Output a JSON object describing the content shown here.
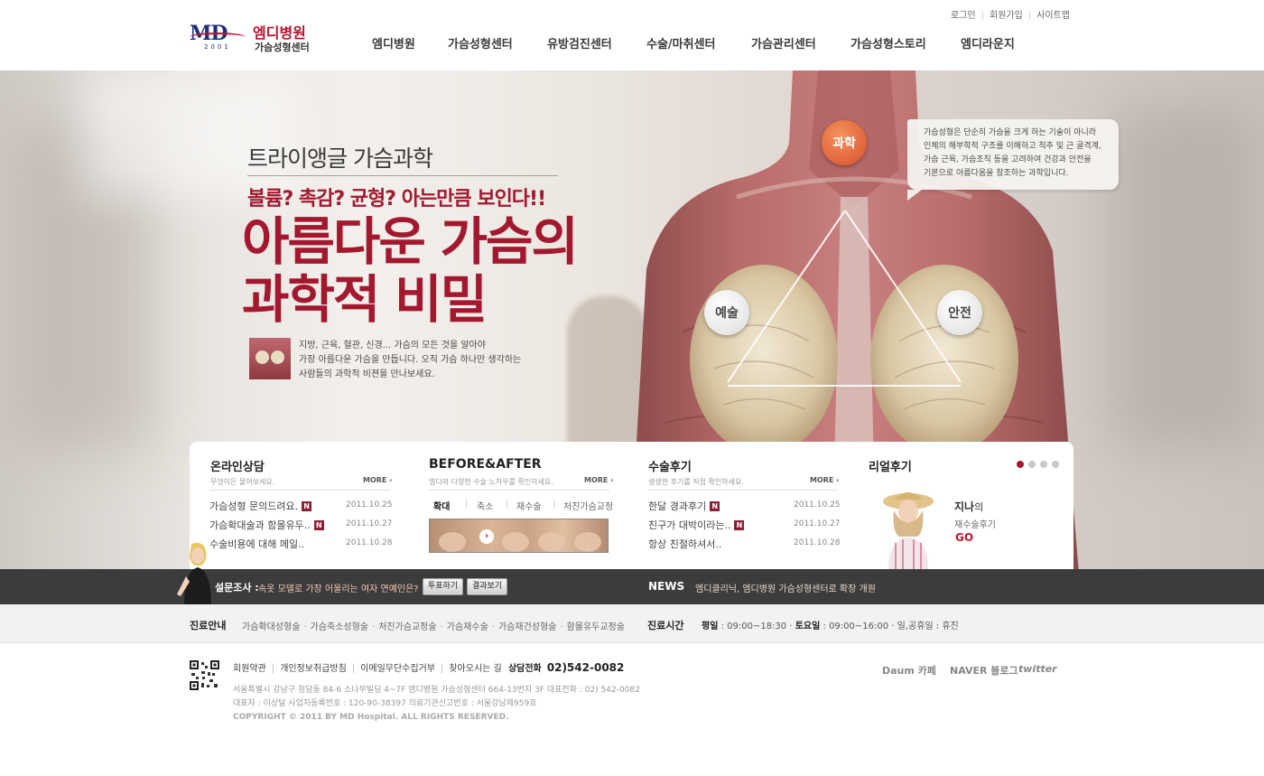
{
  "header": {
    "logo_text": "MD",
    "logo_year": "2001",
    "hospital_name": "엠디병원",
    "center_name": "가슴성형센터",
    "util_links": [
      "로그인",
      "회원가입",
      "사이트맵"
    ],
    "nav": [
      "엠디병원",
      "가슴성형센터",
      "유방검진센터",
      "수술/마취센터",
      "가슴관리센터",
      "가슴성형스토리",
      "엠디라운지"
    ]
  },
  "hero": {
    "subtitle": "트라이앵글 가슴과학",
    "slogan": "볼륨? 촉감? 균형? 아는만큼 보인다!!",
    "title_line1": "아름다운 가슴의",
    "title_line2": "과학적 비밀",
    "desc_line1": "지방, 근육, 혈관, 신경... 가슴의 모든 것을 알아야",
    "desc_line2": "가장 아름다운 가슴을 만듭니다. 오직 가슴 하나만 생각하는",
    "desc_line3": "사람들의 과학적 비젼을 만나보세요.",
    "triangle": {
      "top": "과학",
      "left": "예술",
      "right": "안전"
    },
    "bubble_lines": [
      "가슴성형은 단순히 가슴을 크게 하는 기술이 아니라",
      "인체의 해부학적 구조를 이해하고 척추 및 근 골격계,",
      "가슴 근육, 가슴조직 등을 고려하여 건강과 안전을",
      "기본으로 아름다움을 창조하는 과학입니다."
    ]
  },
  "consult": {
    "title": "온라인상담",
    "sub": "무엇이든 물어보세요.",
    "more": "MORE",
    "items": [
      {
        "text": "가슴성형 문의드려요.",
        "new": "N",
        "date": "2011.10.25"
      },
      {
        "text": "가슴확대술과 함몰유두..",
        "new": "N",
        "date": "2011.10.27"
      },
      {
        "text": "수술비용에 대해 메일..",
        "new": "",
        "date": "2011.10.28"
      }
    ]
  },
  "before_after": {
    "title": "BEFORE&AFTER",
    "sub": "엠디의 다양한 수술 노하우를 확인하세요.",
    "more": "MORE",
    "tabs": [
      "확대",
      "축소",
      "재수술",
      "처진가슴교정"
    ]
  },
  "review": {
    "title": "수술후기",
    "sub": "생생한 후기를 직접 확인하세요.",
    "more": "MORE",
    "items": [
      {
        "text": "한달 경과후기",
        "new": "N",
        "date": "2011.10.25"
      },
      {
        "text": "친구가 대박이라는..",
        "new": "N",
        "date": "2011.10.27"
      },
      {
        "text": "항상 친절하셔서..",
        "new": "",
        "date": "2011.10.28"
      }
    ]
  },
  "real_review": {
    "title": "리얼후기",
    "name": "지나",
    "name_suffix": "의",
    "sub": "재수술후기",
    "go": "GO",
    "slide_count": 4,
    "active_slide": 1
  },
  "poll": {
    "label": "설문조사 :",
    "question": "속옷 모델로 가장 어울리는 여자 연예인은?",
    "vote_button": "투표하기",
    "result_button": "결과보기"
  },
  "news": {
    "label": "NEWS",
    "text": "엠디클리닉, 엠디병원 가슴성형센터로 확장 개원"
  },
  "info": {
    "treatment_label": "진료안내",
    "treatments": [
      "가슴확대성형술",
      "가슴축소성형술",
      "처진가슴교정술",
      "가슴재수술",
      "가슴재건성형술",
      "함몰유두교정술"
    ],
    "hours_label": "진료시간",
    "hours": {
      "weekday_label": "평일",
      "weekday": ": 09:00~18:30",
      "saturday_label": "토요일",
      "saturday": ": 09:00~16:00",
      "holiday": "일,공휴일 : 휴진"
    }
  },
  "footer": {
    "links": [
      "회원약관",
      "개인정보취급방침",
      "이메일무단수집거부",
      "찾아오시는 길"
    ],
    "tel_label": "상담전화",
    "tel": "02)542-0082",
    "address": "서울특별시 강남구 청담동 84-6 소나무빌딩 4~7F 엠디병원 가슴성형센터   664-13번지 3F  대표전화 : 02) 542-0082",
    "business": "대표자 : 이상달    사업자등록번호 : 120-90-38397    의료기관신고번호 : 서울강남제959호",
    "copyright": "COPYRIGHT © 2011 BY MD Hospital. ALL RIGHTS RESERVED.",
    "social": [
      "Daum 카페",
      "NAVER 블로그",
      "twitter"
    ]
  },
  "colors": {
    "brand_red": "#a3182f",
    "navy": "#1f2e7c",
    "dark_band": "#3c3c3c",
    "badge": "#8e1e35"
  }
}
